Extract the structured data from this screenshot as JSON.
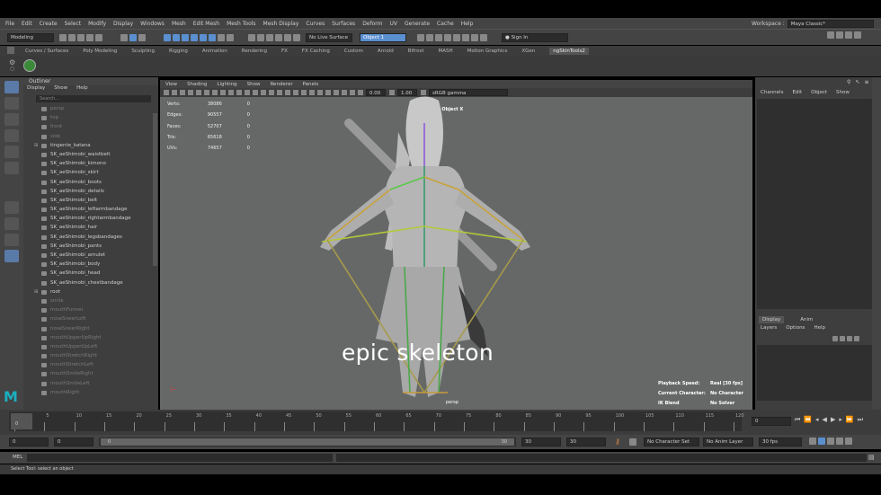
{
  "menubar": {
    "items": [
      "File",
      "Edit",
      "Create",
      "Select",
      "Modify",
      "Display",
      "Windows",
      "Mesh",
      "Edit Mesh",
      "Mesh Tools",
      "Mesh Display",
      "Curves",
      "Surfaces",
      "Deform",
      "UV",
      "Generate",
      "Cache",
      "Help"
    ],
    "workspace_label": "Workspace :",
    "workspace_value": "Maya Classic*"
  },
  "statusline": {
    "mode": "Modeling",
    "live_surface": "No Live Surface",
    "object_field": "Object 1",
    "sign_in": "Sign In"
  },
  "shelf_tabs": [
    "Curves / Surfaces",
    "Poly Modeling",
    "Sculpting",
    "Rigging",
    "Animation",
    "Rendering",
    "FX",
    "FX Caching",
    "Custom",
    "Arnold",
    "Bifrost",
    "MASH",
    "Motion Graphics",
    "XGen",
    "ngSkinTools2"
  ],
  "outliner": {
    "title": "Outliner",
    "menu": [
      "Display",
      "Show",
      "Help"
    ],
    "search_placeholder": "Search...",
    "items": [
      {
        "label": "persp",
        "dim": true
      },
      {
        "label": "top",
        "dim": true
      },
      {
        "label": "front",
        "dim": true
      },
      {
        "label": "side",
        "dim": true
      },
      {
        "label": "tingente_katana",
        "dim": false,
        "expand": true
      },
      {
        "label": "SK_aeShimobi_waistbelt",
        "dim": false
      },
      {
        "label": "SK_aeShimobi_kimono",
        "dim": false
      },
      {
        "label": "SK_aeShimobi_skirt",
        "dim": false
      },
      {
        "label": "SK_aeShimobi_boots",
        "dim": false
      },
      {
        "label": "SK_aeShimobi_details",
        "dim": false
      },
      {
        "label": "SK_aeShimobi_belt",
        "dim": false
      },
      {
        "label": "SK_aeShimobi_leftarmbandage",
        "dim": false
      },
      {
        "label": "SK_aeShimobi_rightarmbandage",
        "dim": false
      },
      {
        "label": "SK_aeShimobi_hair",
        "dim": false
      },
      {
        "label": "SK_aeShimobi_legsbandages",
        "dim": false
      },
      {
        "label": "SK_aeShimobi_pants",
        "dim": false
      },
      {
        "label": "SK_aeShimobi_amulet",
        "dim": false
      },
      {
        "label": "SK_aeShimobi_body",
        "dim": false
      },
      {
        "label": "SK_aeShimobi_head",
        "dim": false
      },
      {
        "label": "SK_aeShimobi_chestbandage",
        "dim": false
      },
      {
        "label": "root",
        "dim": false,
        "expand": true
      },
      {
        "label": "smile",
        "dim": true
      },
      {
        "label": "mouthFunnel",
        "dim": true
      },
      {
        "label": "noseSneerLeft",
        "dim": true
      },
      {
        "label": "noseSneerRight",
        "dim": true
      },
      {
        "label": "mouthUpperUpRight",
        "dim": true
      },
      {
        "label": "mouthUpperUpLeft",
        "dim": true
      },
      {
        "label": "mouthStretchRight",
        "dim": true
      },
      {
        "label": "mouthStretchLeft",
        "dim": true
      },
      {
        "label": "mouthSmileRight",
        "dim": true
      },
      {
        "label": "mouthSmileLeft",
        "dim": true
      },
      {
        "label": "mouthRight",
        "dim": true
      }
    ]
  },
  "viewport": {
    "menu": [
      "View",
      "Shading",
      "Lighting",
      "Show",
      "Renderer",
      "Panels"
    ],
    "field1": "0.00",
    "field2": "1.00",
    "color_space": "sRGB gamma",
    "hud_labels": [
      "Verts:",
      "Edges:",
      "Faces:",
      "Tris:",
      "UVs:"
    ],
    "hud_values": [
      "38086",
      "90557",
      "52707",
      "65618",
      "74657"
    ],
    "hud_zero": [
      "0",
      "0",
      "0",
      "0",
      "0"
    ],
    "geometry_label": "Geometry: Object X",
    "camera_label": "persp",
    "playback_speed_label": "Playback Speed:",
    "playback_speed_value": "Real [30 fps]",
    "current_character_label": "Current Character:",
    "current_character_value": "No Character",
    "ik_blend_label": "IK Blend",
    "ik_blend_value": "No Solver",
    "caption": "epic skeleton"
  },
  "channels": {
    "menu": [
      "Channels",
      "Edit",
      "Object",
      "Show"
    ],
    "layer_tabs": [
      "Display",
      "Anim"
    ],
    "layer_menu": [
      "Layers",
      "Options",
      "Help"
    ]
  },
  "timeline": {
    "ticks": [
      "1",
      "5",
      "10",
      "15",
      "20",
      "25",
      "30",
      "35",
      "40",
      "45",
      "50",
      "55",
      "60",
      "65",
      "70",
      "75",
      "80",
      "85",
      "90",
      "95",
      "100",
      "105",
      "110",
      "115",
      "120"
    ],
    "current_frame_box": "0",
    "current_frame": "0"
  },
  "range": {
    "start": "0",
    "start_inner": "0",
    "slider_start": "0",
    "slider_end": "30",
    "end_inner": "30",
    "end": "30",
    "character_set": "No Character Set",
    "anim_layer": "No Anim Layer",
    "fps": "30 fps"
  },
  "cmdline": {
    "label": "MEL"
  },
  "helpline": {
    "text": "Select Tool: select an object"
  }
}
